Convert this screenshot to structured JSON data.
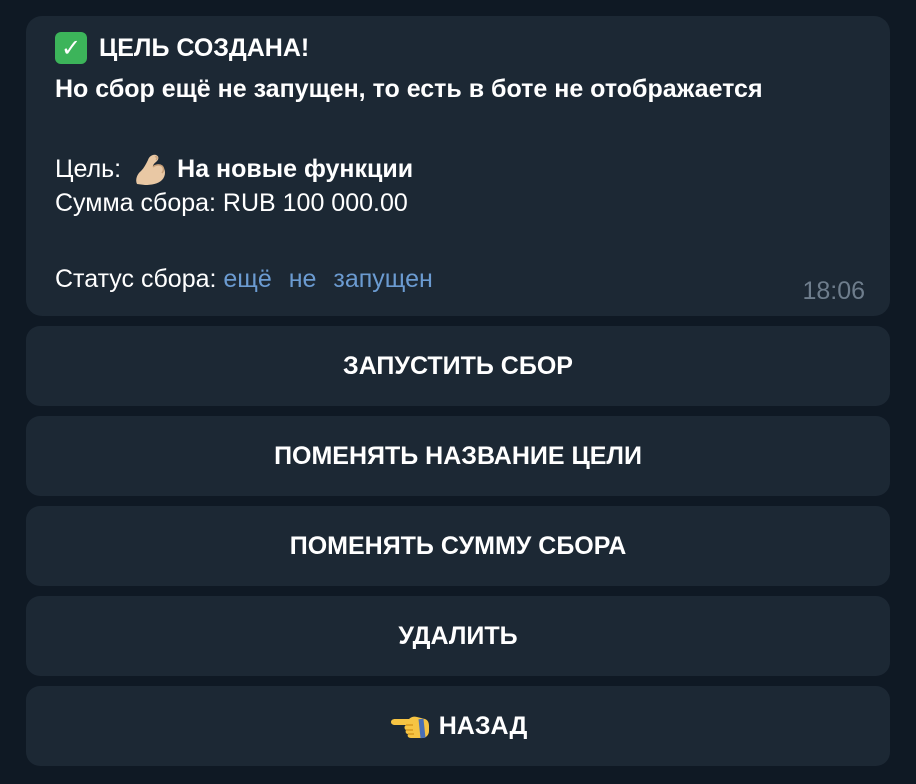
{
  "message": {
    "headline": "ЦЕЛЬ СОЗДАНА!",
    "subheadline": "Но сбор ещё не запущен, то есть в боте не отображается",
    "goal_label": "Цель:",
    "goal_value": "На новые функции",
    "amount_text": "Сумма сбора: RUB 100 000.00",
    "status_label": "Статус сбора:",
    "status_value": "ещё не запущен",
    "time": "18:06",
    "icons": {
      "headline": "check-mark-icon",
      "goal": "flexed-biceps-icon"
    },
    "colors": {
      "status_link": "#6b9bd1",
      "bubble": "#1c2834",
      "background": "#0f1924"
    }
  },
  "keyboard": {
    "buttons": [
      {
        "label": "ЗАПУСТИТЬ СБОР"
      },
      {
        "label": "ПОМЕНЯТЬ НАЗВАНИЕ ЦЕЛИ"
      },
      {
        "label": "ПОМЕНЯТЬ СУММУ СБОРА"
      },
      {
        "label": "УДАЛИТЬ"
      },
      {
        "label": "НАЗАД",
        "icon": "pointing-left-hand-icon"
      }
    ]
  }
}
